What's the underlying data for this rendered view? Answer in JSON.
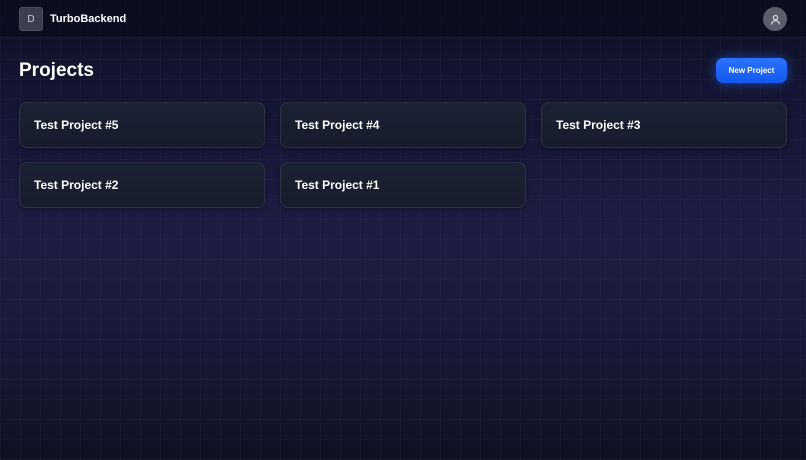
{
  "header": {
    "logo_letter": "D",
    "app_title": "TurboBackend",
    "avatar_icon": "user-icon"
  },
  "main": {
    "page_title": "Projects",
    "new_project_label": "New Project",
    "projects": [
      {
        "name": "Test Project #5"
      },
      {
        "name": "Test Project #4"
      },
      {
        "name": "Test Project #3"
      },
      {
        "name": "Test Project #2"
      },
      {
        "name": "Test Project #1"
      }
    ]
  },
  "colors": {
    "accent": "#1a62ff",
    "background": "#181937",
    "card": "#1a2131"
  }
}
